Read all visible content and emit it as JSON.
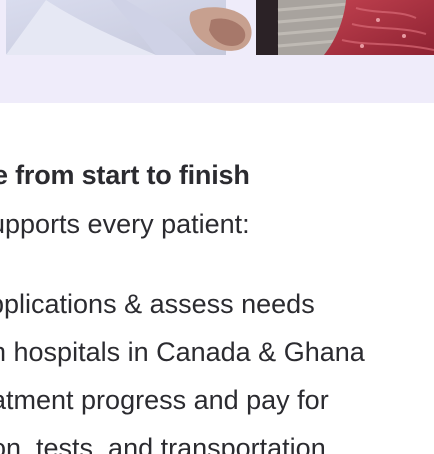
{
  "section": {
    "heading": "e from start to finish",
    "intro": "upports every patient:",
    "features": [
      "pplications & assess needs",
      "h hospitals in Canada & Ghana",
      "atment progress and pay for",
      "on, tests, and transportation"
    ]
  },
  "colors": {
    "band_background": "#efecfa",
    "text": "#2b2b30"
  }
}
